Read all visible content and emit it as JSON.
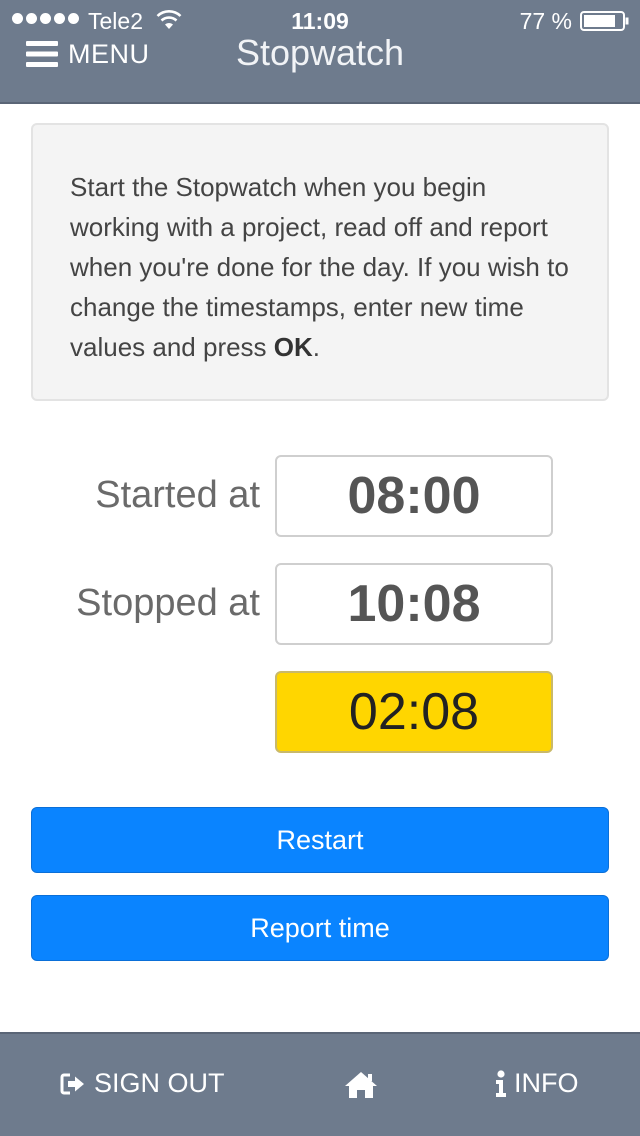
{
  "status_bar": {
    "carrier": "Tele2",
    "time": "11:09",
    "battery_percent": "77 %",
    "signal_icon": "signal-dots-icon",
    "wifi_icon": "wifi-icon",
    "battery_icon": "battery-icon"
  },
  "nav": {
    "menu_label": "MENU",
    "menu_icon": "hamburger-icon",
    "title": "Stopwatch"
  },
  "info": {
    "text_before": "Start the Stopwatch when you begin working with a project, read off and report when you're done for the day. If you wish to change the timestamps, enter new time values and press ",
    "text_bold": "OK",
    "text_after": "."
  },
  "times": {
    "started_label": "Started at",
    "started_value": "08:00",
    "stopped_label": "Stopped at",
    "stopped_value": "10:08",
    "duration": "02:08"
  },
  "buttons": {
    "restart_label": "Restart",
    "report_label": "Report time"
  },
  "footer": {
    "sign_out_label": "SIGN OUT",
    "sign_out_icon": "sign-out-icon",
    "home_icon": "home-icon",
    "info_label": "INFO",
    "info_icon": "info-icon"
  },
  "colors": {
    "header_bg": "#6e7b8d",
    "button_bg": "#0a84ff",
    "duration_bg": "#ffd600",
    "info_box_bg": "#f4f4f4"
  }
}
